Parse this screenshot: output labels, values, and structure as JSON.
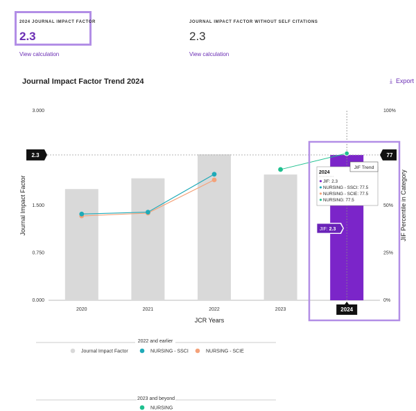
{
  "metrics": {
    "jif": {
      "label": "2024 JOURNAL IMPACT FACTOR",
      "value": "2.3",
      "link": "View calculation"
    },
    "jif_no_self": {
      "label": "JOURNAL IMPACT FACTOR WITHOUT SELF CITATIONS",
      "value": "2.3",
      "link": "View calculation"
    }
  },
  "section_title": "Journal Impact Factor Trend 2024",
  "export_label": "Export",
  "colors": {
    "bar": "#d9d9d9",
    "bar_highlight": "#7b25c9",
    "ssci": "#1faab8",
    "scie": "#f4a27a",
    "nursing": "#1fc08f",
    "accent": "#6a2db4",
    "highlight_border": "#b28ee6"
  },
  "chart_data": {
    "type": "bar",
    "categories": [
      "2020",
      "2021",
      "2022",
      "2023",
      "2024"
    ],
    "xlabel": "JCR Years",
    "ylabel": "Journal Impact Factor",
    "y2label": "JIF Percentile in Category",
    "ylim": [
      0,
      3
    ],
    "yticks": [
      "0.000",
      "0.750",
      "1.500",
      "2.250",
      "3.000"
    ],
    "yticks_shown": [
      "0.000",
      "0.750",
      "1.500",
      "3.000"
    ],
    "y2lim": [
      0,
      100
    ],
    "y2ticks": [
      "0%",
      "25%",
      "50%",
      "100%"
    ],
    "y2tick_values": [
      0,
      25,
      50,
      100
    ],
    "series": [
      {
        "name": "Journal Impact Factor",
        "kind": "bar",
        "values": [
          1.76,
          1.93,
          2.31,
          1.99,
          2.3
        ]
      },
      {
        "name": "NURSING - SSCI",
        "kind": "line",
        "percentiles": [
          45.5,
          46.5,
          66.5,
          null,
          null
        ]
      },
      {
        "name": "NURSING - SCIE",
        "kind": "line",
        "percentiles": [
          44.5,
          46.0,
          63.5,
          null,
          null
        ]
      },
      {
        "name": "NURSING",
        "kind": "point",
        "percentiles": [
          null,
          null,
          null,
          69.0,
          77.5
        ]
      }
    ],
    "ref_left_label": "2.3",
    "ref_right_label": "77",
    "selected_label": "2024",
    "jif_badge": {
      "prefix": "JIF:",
      "value": "2.3"
    },
    "tooltip": {
      "title": "2024",
      "rows": [
        {
          "label": "JIF: 2.3",
          "color": "#7b25c9"
        },
        {
          "label": "NURSING - SSCI: 77.5",
          "color": "#1faab8"
        },
        {
          "label": "NURSING - SCIE: 77.5",
          "color": "#f4a27a"
        },
        {
          "label": "NURSING: 77.5",
          "color": "#1fc08f"
        }
      ],
      "trend_label": "JIF Trend"
    },
    "legend_groups": [
      {
        "title": "2022 and earlier",
        "items": [
          "Journal Impact Factor",
          "NURSING - SSCI",
          "NURSING - SCIE"
        ]
      },
      {
        "title": "2023 and beyond",
        "items": [
          "NURSING"
        ]
      }
    ]
  }
}
